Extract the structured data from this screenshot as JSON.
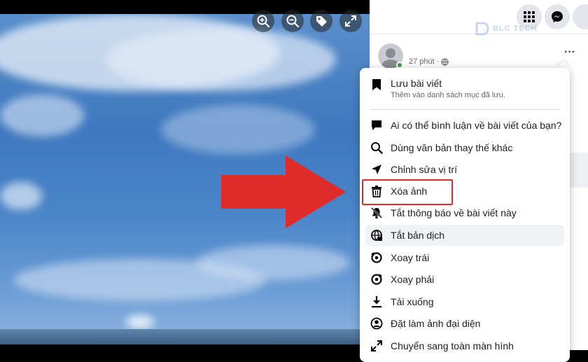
{
  "photo_viewer": {
    "controls": [
      {
        "name": "zoom-in-icon"
      },
      {
        "name": "zoom-out-icon"
      },
      {
        "name": "tag-icon"
      },
      {
        "name": "fullscreen-icon"
      }
    ]
  },
  "header": {
    "watermark_text": "BLC TECH"
  },
  "post": {
    "time": "27 phút",
    "privacy_icon": "globe-icon",
    "more_label": "···"
  },
  "menu": {
    "save": {
      "label": "Lưu bài viết",
      "sub": "Thêm vào danh sách mục đã lưu."
    },
    "items": [
      {
        "label": "Ai có thể bình luận về bài viết của bạn?",
        "icon": "comment-icon"
      },
      {
        "label": "Dùng văn bản thay thế khác",
        "icon": "search-icon"
      },
      {
        "label": "Chỉnh sửa vị trí",
        "icon": "location-arrow-icon"
      },
      {
        "label": "Xóa ảnh",
        "icon": "trash-icon"
      },
      {
        "label": "Tắt thông báo về bài viết này",
        "icon": "bell-off-icon"
      },
      {
        "label": "Tắt bản dịch",
        "icon": "globe-translate-icon"
      },
      {
        "label": "Xoay trái",
        "icon": "rotate-left-icon"
      },
      {
        "label": "Xoay phải",
        "icon": "rotate-right-icon"
      },
      {
        "label": "Tải xuống",
        "icon": "download-icon"
      },
      {
        "label": "Đặt làm ảnh đại diện",
        "icon": "profile-icon"
      },
      {
        "label": "Chuyển sang toàn màn hình",
        "icon": "expand-icon"
      }
    ]
  },
  "colors": {
    "annotation_red": "#e02b2b",
    "online_green": "#31a24c"
  }
}
